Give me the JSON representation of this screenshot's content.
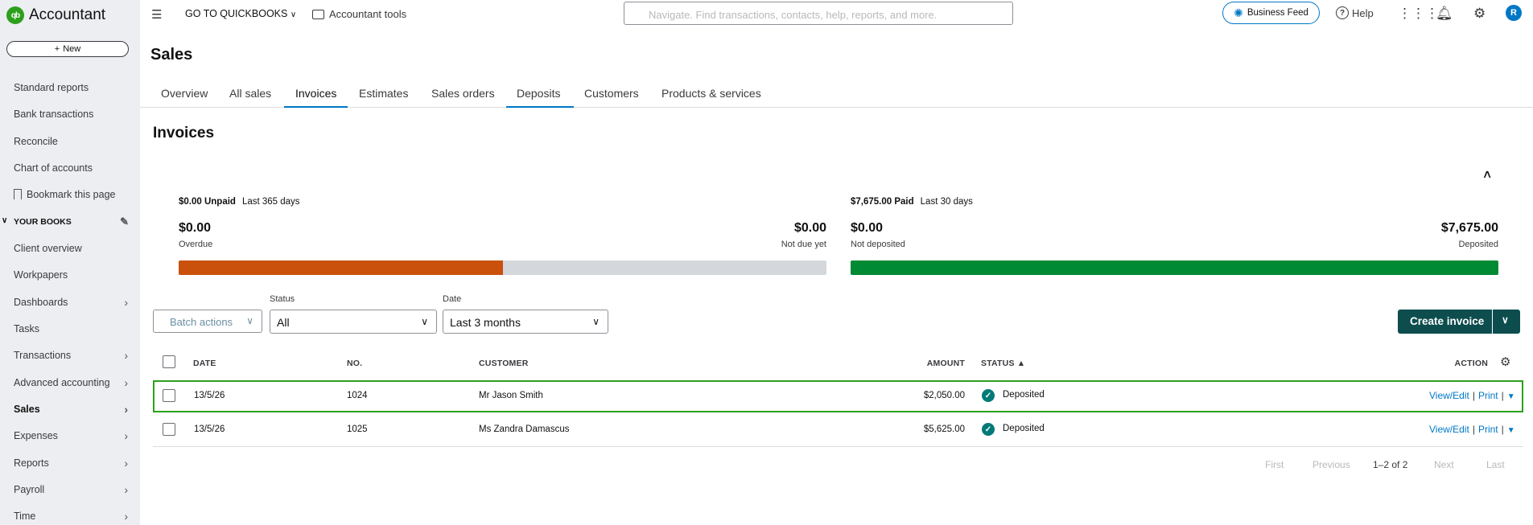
{
  "app": {
    "name": "Accountant",
    "logo_text": "qb"
  },
  "sidebar": {
    "new_label": "New",
    "items_top": [
      {
        "label": "Standard reports"
      },
      {
        "label": "Bank transactions"
      },
      {
        "label": "Reconcile"
      },
      {
        "label": "Chart of accounts"
      },
      {
        "label": "Bookmark this page"
      }
    ],
    "your_books_label": "YOUR BOOKS",
    "items_books": [
      {
        "label": "Client overview"
      },
      {
        "label": "Workpapers"
      },
      {
        "label": "Dashboards",
        "has_chevron": true
      },
      {
        "label": "Tasks"
      },
      {
        "label": "Transactions",
        "has_chevron": true
      },
      {
        "label": "Advanced accounting",
        "has_chevron": true
      },
      {
        "label": "Sales",
        "has_chevron": true,
        "active": true
      },
      {
        "label": "Expenses",
        "has_chevron": true
      },
      {
        "label": "Reports",
        "has_chevron": true
      },
      {
        "label": "Payroll",
        "has_chevron": true
      },
      {
        "label": "Time",
        "has_chevron": true
      }
    ]
  },
  "topbar": {
    "goto_label": "GO TO QUICKBOOKS",
    "accountant_tools_label": "Accountant tools",
    "search_placeholder": "Navigate. Find transactions, contacts, help, reports, and more.",
    "business_feed_label": "Business Feed",
    "help_label": "Help",
    "avatar_initial": "R"
  },
  "page": {
    "title": "Sales",
    "tabs": [
      "Overview",
      "All sales",
      "Invoices",
      "Estimates",
      "Sales orders",
      "Deposits",
      "Customers",
      "Products & services"
    ],
    "active_tab": "Invoices",
    "section_title": "Invoices"
  },
  "summary": {
    "unpaid": {
      "amount_label": "$0.00 Unpaid",
      "period": "Last 365 days",
      "overdue_amount": "$0.00",
      "overdue_label": "Overdue",
      "not_due_amount": "$0.00",
      "not_due_label": "Not due yet",
      "overdue_fraction": 0.5
    },
    "paid": {
      "amount_label": "$7,675.00 Paid",
      "period": "Last 30 days",
      "not_deposited_amount": "$0.00",
      "not_deposited_label": "Not deposited",
      "deposited_amount": "$7,675.00",
      "deposited_label": "Deposited",
      "deposited_fraction": 1.0
    }
  },
  "filters": {
    "batch_actions_label": "Batch actions",
    "status_label": "Status",
    "status_value": "All",
    "date_label": "Date",
    "date_value": "Last 3 months",
    "create_invoice_label": "Create invoice"
  },
  "table": {
    "headers": {
      "date": "DATE",
      "no": "NO.",
      "customer": "CUSTOMER",
      "amount": "AMOUNT",
      "status": "STATUS ▲",
      "action": "ACTION"
    },
    "rows": [
      {
        "date": "13/5/26",
        "no": "1024",
        "customer": "Mr Jason Smith",
        "amount": "$2,050.00",
        "status": "Deposited",
        "view_edit": "View/Edit",
        "print": "Print"
      },
      {
        "date": "13/5/26",
        "no": "1025",
        "customer": "Ms Zandra Damascus",
        "amount": "$5,625.00",
        "status": "Deposited",
        "view_edit": "View/Edit",
        "print": "Print"
      }
    ]
  },
  "pagination": {
    "first": "First",
    "previous": "Previous",
    "range": "1–2 of 2",
    "next": "Next",
    "last": "Last"
  },
  "colors": {
    "overdue_bar": "#c9510c",
    "not_due_bar": "#d4d7dc",
    "deposited_bar": "#008a33",
    "primary_button": "#0d4d4e",
    "link": "#0077c5",
    "selected_row_border": "#2ca01c"
  }
}
